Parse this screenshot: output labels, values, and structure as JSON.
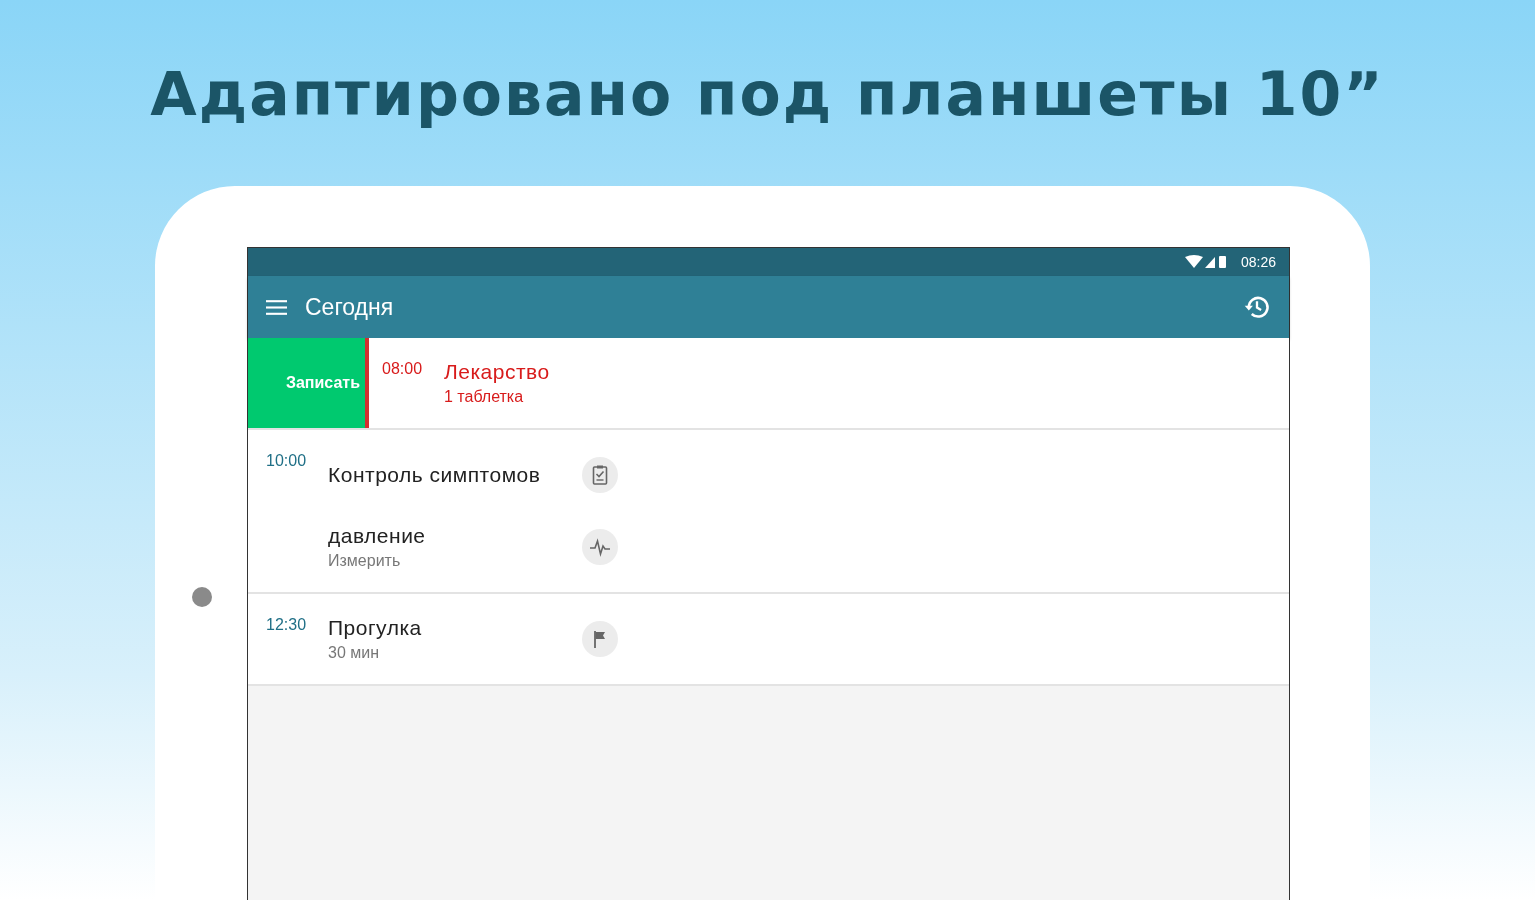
{
  "headline": "Адаптировано под планшеты 10”",
  "status_bar": {
    "time": "08:26"
  },
  "app_bar": {
    "title": "Сегодня"
  },
  "schedule": [
    {
      "time": "08:00",
      "overdue": true,
      "swipe_action": "Записать",
      "entries": [
        {
          "kind": "medication",
          "title": "Лекарство",
          "subtitle": "1 таблетка"
        }
      ]
    },
    {
      "time": "10:00",
      "overdue": false,
      "entries": [
        {
          "kind": "checklist",
          "title": "Контроль симптомов"
        },
        {
          "kind": "measurement",
          "title": "давление",
          "subtitle": "Измерить"
        }
      ]
    },
    {
      "time": "12:30",
      "overdue": false,
      "entries": [
        {
          "kind": "activity",
          "title": "Прогулка",
          "subtitle": "30 мин"
        }
      ]
    }
  ]
}
